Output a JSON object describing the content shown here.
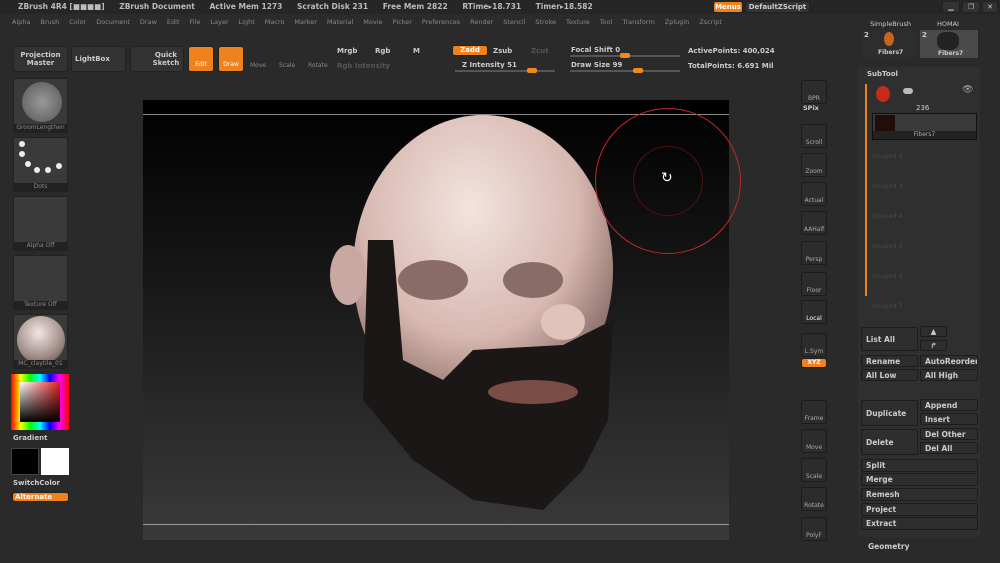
{
  "titlebar": {
    "app": "ZBrush 4R4 [■■■■]",
    "doc": "ZBrush Document",
    "active_mem": "Active Mem 1273",
    "scratch": "Scratch Disk 231",
    "free_mem": "Free Mem 2822",
    "rtime": "RTime▸18.731",
    "timer": "Timer▸18.582",
    "menus": "Menus",
    "script": "DefaultZScript"
  },
  "menu": [
    "Alpha",
    "Brush",
    "Color",
    "Document",
    "Draw",
    "Edit",
    "File",
    "Layer",
    "Light",
    "Macro",
    "Marker",
    "Material",
    "Movie",
    "Picker",
    "Preferences",
    "Render",
    "Stencil",
    "Stroke",
    "Texture",
    "Tool",
    "Transform",
    "Zplugin",
    "Zscript"
  ],
  "toolbar": {
    "projection_master": "Projection Master",
    "lightbox": "LightBox",
    "quick_sketch": "Quick Sketch",
    "edit": "Edit",
    "draw": "Draw",
    "move": "Move",
    "scale": "Scale",
    "rotate": "Rotate",
    "mrgb": "Mrgb",
    "rgb": "Rgb",
    "m": "M",
    "rgb_intensity": "Rgb Intensity",
    "zadd": "Zadd",
    "zsub": "Zsub",
    "zcut": "Zcut",
    "z_intensity": "Z Intensity 51",
    "focal_shift": "Focal Shift 0",
    "draw_size": "Draw Size 99",
    "active_points": "ActivePoints: 400,024",
    "total_points": "TotalPoints: 6.691 Mil",
    "z_intensity_value": 51,
    "focal_shift_value": 0,
    "draw_size_value": 99
  },
  "left": {
    "brush": "GroomLengthen",
    "stroke": "Dots",
    "alpha": "Alpha Off",
    "texture": "Texture Off",
    "material": "MC_claytile_01",
    "gradient": "Gradient",
    "switchcolor": "SwitchColor",
    "alternate": "Alternate"
  },
  "right_shelf": [
    "BPR",
    "SPix",
    "Scroll",
    "Zoom",
    "Actual",
    "AAHalf",
    "Persp",
    "Floor",
    "Local",
    "L.Sym",
    "XYZ",
    "Frame",
    "Move",
    "Scale",
    "Rotate",
    "PolyF"
  ],
  "tool_thumbs": {
    "simple": "SimpleBrush",
    "homai": "HOMAI",
    "fibers_a": "Fibers7",
    "fibers_b": "Fibers7",
    "count_a": "2",
    "count_b": "2"
  },
  "subtool": {
    "title": "SubTool",
    "count": "236",
    "item": "Fibers7",
    "empty": [
      "Unused 2",
      "Unused 3",
      "Unused 4",
      "Unused 5",
      "Unused 6",
      "Unused 7"
    ],
    "list_all": "List All",
    "rename": "Rename",
    "autoreorder": "AutoReorder",
    "all_low": "All Low",
    "all_high": "All High",
    "duplicate": "Duplicate",
    "append": "Append",
    "insert": "Insert",
    "delete": "Delete",
    "del_other": "Del Other",
    "del_all": "Del All",
    "split": "Split",
    "merge": "Merge",
    "remesh": "Remesh",
    "project": "Project",
    "extract": "Extract",
    "geometry": "Geometry"
  },
  "colors": {
    "accent": "#f0821e",
    "brush_circle": "#c0282a"
  }
}
